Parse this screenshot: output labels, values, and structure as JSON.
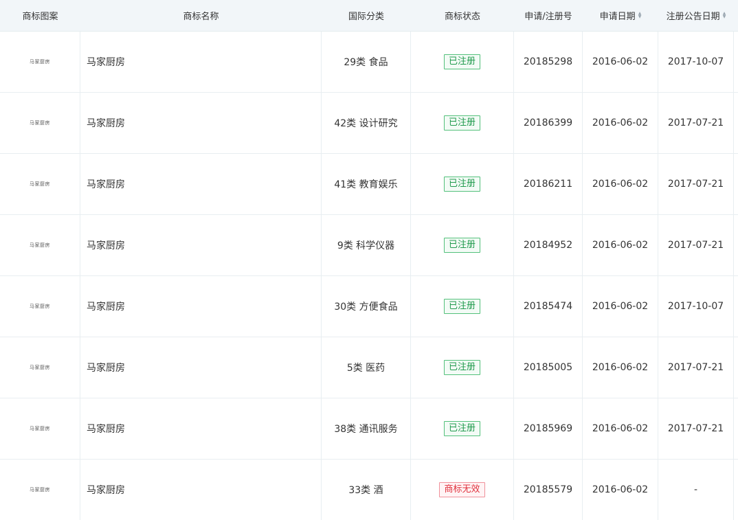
{
  "headers": {
    "logo": "商标图案",
    "name": "商标名称",
    "class": "国际分类",
    "status": "商标状态",
    "reg_no": "申请/注册号",
    "apply_date": "申请日期",
    "announce_date": "注册公告日期"
  },
  "rows": [
    {
      "logo_text": "马家厨房",
      "name": "马家厨房",
      "class": "29类 食品",
      "status": "已注册",
      "reg_no": "20185298",
      "apply_date": "2016-06-02",
      "announce_date": "2017-10-07"
    },
    {
      "logo_text": "马家厨房",
      "name": "马家厨房",
      "class": "42类 设计研究",
      "status": "已注册",
      "reg_no": "20186399",
      "apply_date": "2016-06-02",
      "announce_date": "2017-07-21"
    },
    {
      "logo_text": "马家厨房",
      "name": "马家厨房",
      "class": "41类 教育娱乐",
      "status": "已注册",
      "reg_no": "20186211",
      "apply_date": "2016-06-02",
      "announce_date": "2017-07-21"
    },
    {
      "logo_text": "马家厨房",
      "name": "马家厨房",
      "class": "9类 科学仪器",
      "status": "已注册",
      "reg_no": "20184952",
      "apply_date": "2016-06-02",
      "announce_date": "2017-07-21"
    },
    {
      "logo_text": "马家厨房",
      "name": "马家厨房",
      "class": "30类 方便食品",
      "status": "已注册",
      "reg_no": "20185474",
      "apply_date": "2016-06-02",
      "announce_date": "2017-10-07"
    },
    {
      "logo_text": "马家厨房",
      "name": "马家厨房",
      "class": "5类 医药",
      "status": "已注册",
      "reg_no": "20185005",
      "apply_date": "2016-06-02",
      "announce_date": "2017-07-21"
    },
    {
      "logo_text": "马家厨房",
      "name": "马家厨房",
      "class": "38类 通讯服务",
      "status": "已注册",
      "reg_no": "20185969",
      "apply_date": "2016-06-02",
      "announce_date": "2017-07-21"
    },
    {
      "logo_text": "马家厨房",
      "name": "马家厨房",
      "class": "33类 酒",
      "status": "商标无效",
      "reg_no": "20185579",
      "apply_date": "2016-06-02",
      "announce_date": "-"
    }
  ],
  "colors": {
    "status_registered": "#1f9a4c",
    "status_invalid": "#e0313d",
    "header_bg": "#f2f6f9"
  },
  "icons": {
    "sort": "sort-caret-icon"
  }
}
